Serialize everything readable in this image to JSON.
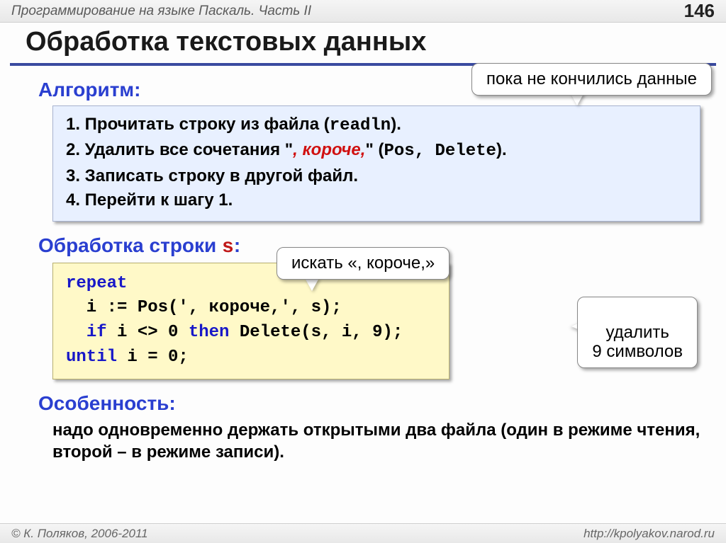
{
  "header": {
    "course": "Программирование на языке Паскаль. Часть II",
    "page": "146"
  },
  "title": "Обработка текстовых данных",
  "callouts": {
    "top": "пока не кончились данные",
    "search": "искать «, короче,»",
    "delete": "удалить\n9 символов"
  },
  "sections": {
    "algo_label": "Алгоритм:",
    "algo": {
      "line1_a": "1. Прочитать строку из файла (",
      "line1_b": "readln",
      "line1_c": ").",
      "line2_a": "2. Удалить все сочетания \"",
      "line2_b": ", короче,",
      "line2_c": "\" (",
      "line2_d": "Pos",
      "line2_e": ", ",
      "line2_f": "Delete",
      "line2_g": ").",
      "line3": "3. Записать строку в другой файл.",
      "line4": "4. Перейти к шагу 1."
    },
    "proc_label_a": "Обработка строки ",
    "proc_label_b": "s",
    "proc_label_c": ":",
    "code": {
      "l1": "repeat",
      "l2a": "  i := Pos(', короче,', s);",
      "l3a": "  ",
      "l3b": "if",
      "l3c": " i <> 0 ",
      "l3d": "then",
      "l3e": " Delete(s, i, 9);",
      "l4a": "until",
      "l4b": " i = 0;"
    },
    "feature_label": "Особенность:",
    "feature_text": "надо одновременно держать открытыми два файла (один в режиме чтения, второй – в режиме записи)."
  },
  "footer": {
    "copyright": "© К. Поляков, 2006-2011",
    "url": "http://kpolyakov.narod.ru"
  }
}
